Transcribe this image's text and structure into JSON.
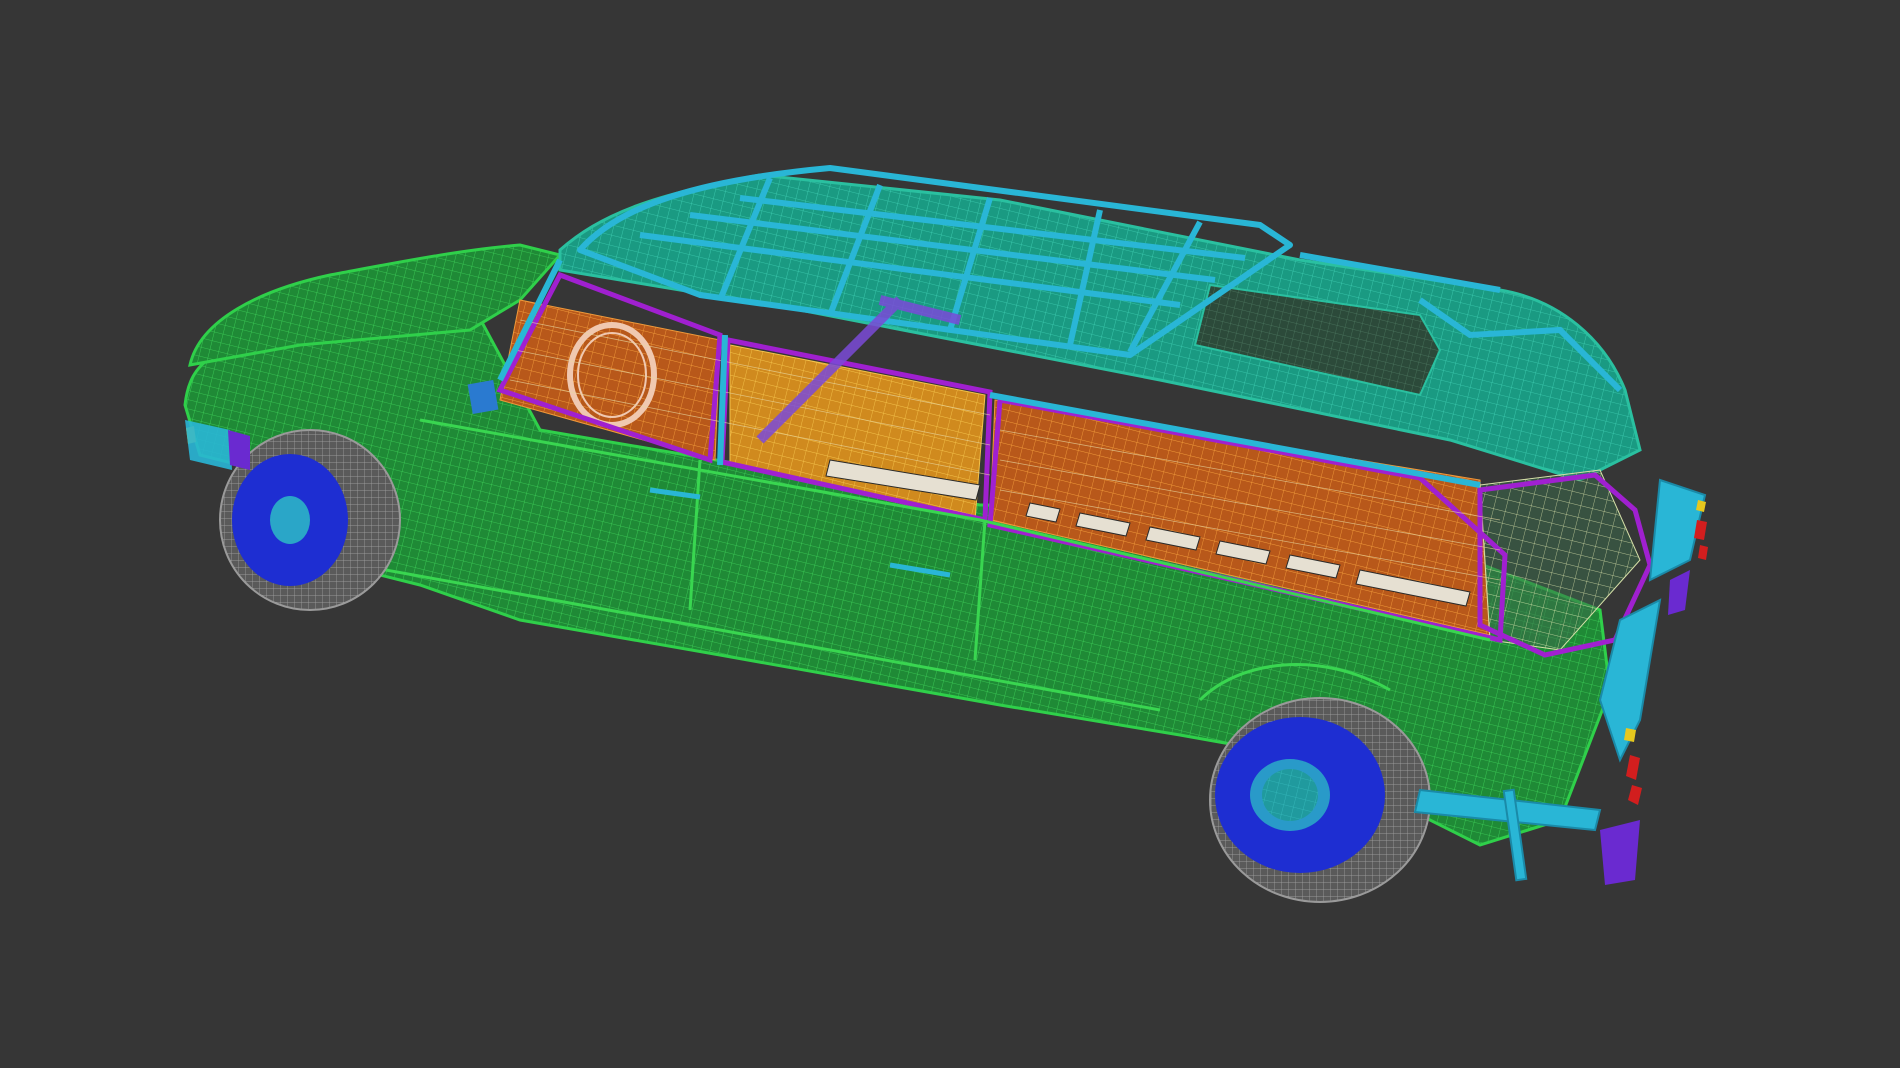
{
  "viewport": {
    "background": "#363636",
    "render_mode": "wireframe"
  },
  "model": {
    "subject": "station-wagon-car",
    "colors": {
      "body": "#1f9a3a",
      "body_line": "#3bd24e",
      "roof": "#1faa8a",
      "roof_rack": "#29b6d6",
      "interior": "#c8641a",
      "interior_light": "#e8a02a",
      "window_frame": "#a020d0",
      "seat_slats": "#e6e0d2",
      "tire": "#8c8c8c",
      "hub": "#1e2ed2",
      "hub_center": "#2aa6c8",
      "tail_light": "#d21e1e",
      "indicator": "#e6c81e"
    }
  }
}
